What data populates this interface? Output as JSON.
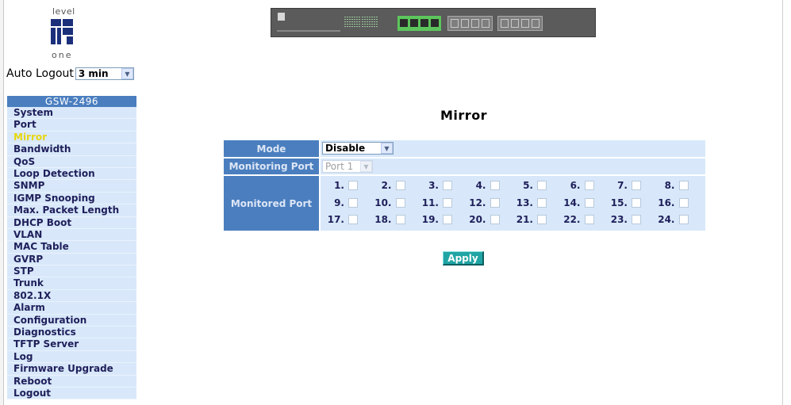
{
  "logo": {
    "top_text": "level",
    "bottom_text": "one"
  },
  "auto_logout": {
    "label": "Auto Logout",
    "value": "3 min"
  },
  "sidebar": {
    "header": "GSW-2496",
    "active_index": 2,
    "items": [
      "System",
      "Port",
      "Mirror",
      "Bandwidth",
      "QoS",
      "Loop Detection",
      "SNMP",
      "IGMP Snooping",
      "Max. Packet Length",
      "DHCP Boot",
      "VLAN",
      "MAC Table",
      "GVRP",
      "STP",
      "Trunk",
      "802.1X",
      "Alarm",
      "Configuration",
      "Diagnostics",
      "TFTP Server",
      "Log",
      "Firmware Upgrade",
      "Reboot",
      "Logout"
    ]
  },
  "page": {
    "title": "Mirror"
  },
  "form": {
    "mode_label": "Mode",
    "mode_value": "Disable",
    "monitoring_label": "Monitoring Port",
    "monitoring_value": "Port 1",
    "monitored_label": "Monitored Port",
    "monitored_ports": [
      "1.",
      "2.",
      "3.",
      "4.",
      "5.",
      "6.",
      "7.",
      "8.",
      "9.",
      "10.",
      "11.",
      "12.",
      "13.",
      "14.",
      "15.",
      "16.",
      "17.",
      "18.",
      "19.",
      "20.",
      "21.",
      "22.",
      "23.",
      "24."
    ]
  },
  "apply_label": "Apply",
  "colors": {
    "accent": "#4a7ebf",
    "panel": "#d8e8fa",
    "active_item": "#e7d60f",
    "apply": "#20a4a4"
  }
}
